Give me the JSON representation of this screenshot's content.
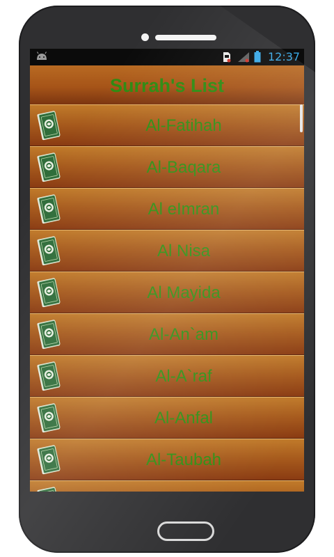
{
  "status_bar": {
    "time": "12:37",
    "icons": [
      "android-icon",
      "sd-card-icon",
      "signal-icon",
      "battery-icon"
    ],
    "time_color": "#38a8e6"
  },
  "app": {
    "title": "Surrah's List",
    "items": [
      {
        "label": "Al-Fatihah",
        "icon": "quran-icon"
      },
      {
        "label": "Al-Baqara",
        "icon": "quran-icon"
      },
      {
        "label": "Al eImran",
        "icon": "quran-icon"
      },
      {
        "label": "Al Nisa",
        "icon": "quran-icon"
      },
      {
        "label": "Al Mayida",
        "icon": "quran-icon"
      },
      {
        "label": "Al-An`am",
        "icon": "quran-icon"
      },
      {
        "label": "Al-A`raf",
        "icon": "quran-icon"
      },
      {
        "label": "Al-Anfal",
        "icon": "quran-icon"
      },
      {
        "label": "Al-Taubah",
        "icon": "quran-icon"
      },
      {
        "label": "",
        "icon": "quran-icon"
      }
    ],
    "colors": {
      "label_green": "#2f8f14",
      "row_brown": "#a85c1d"
    }
  }
}
